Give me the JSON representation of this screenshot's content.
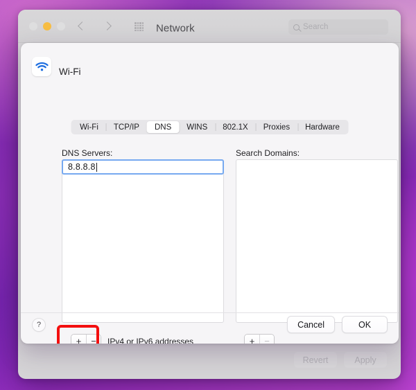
{
  "window": {
    "title": "Network",
    "traffic_lights": [
      "close-red",
      "minimize-yellow",
      "zoom-green"
    ],
    "nav": {
      "back": "back-chevron",
      "forward": "forward-chevron",
      "grid": "all-preferences-grid"
    },
    "search": {
      "placeholder": "Search",
      "icon": "search-icon"
    },
    "background_buttons": {
      "revert": "Revert",
      "apply": "Apply"
    }
  },
  "sheet": {
    "service_name": "Wi-Fi",
    "service_icon": "wifi-icon",
    "tabs": [
      {
        "label": "Wi-Fi",
        "active": false
      },
      {
        "label": "TCP/IP",
        "active": false
      },
      {
        "label": "DNS",
        "active": true
      },
      {
        "label": "WINS",
        "active": false
      },
      {
        "label": "802.1X",
        "active": false
      },
      {
        "label": "Proxies",
        "active": false
      },
      {
        "label": "Hardware",
        "active": false
      }
    ],
    "dns": {
      "label": "DNS Servers:",
      "entries": [
        "8.8.8.8"
      ],
      "editing_value": "8.8.8.8",
      "hint": "IPv4 or IPv6 addresses",
      "add_label": "+",
      "remove_label": "−",
      "remove_enabled": true
    },
    "search_domains": {
      "label": "Search Domains:",
      "entries": [],
      "add_label": "+",
      "remove_label": "−",
      "remove_enabled": false
    },
    "footer": {
      "help_label": "?",
      "cancel_label": "Cancel",
      "ok_label": "OK"
    }
  },
  "annotation": {
    "type": "highlight-rectangle",
    "color": "#f30f0f",
    "target": "dns-add-remove-stepper"
  }
}
